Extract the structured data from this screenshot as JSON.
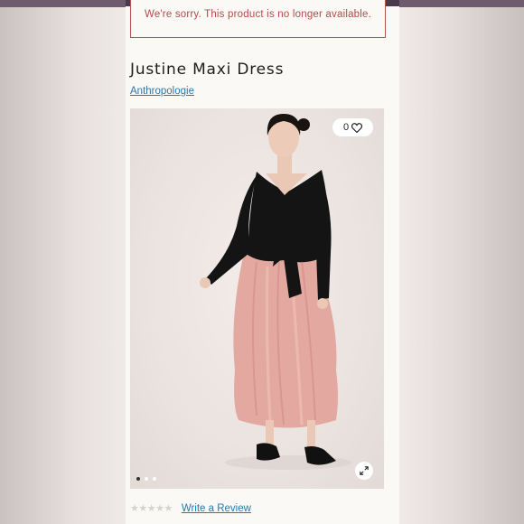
{
  "alert": {
    "message": "We're sorry. This product is no longer available."
  },
  "product": {
    "title": "Justine Maxi Dress",
    "brand": "Anthropologie",
    "image_alt": "Model wearing black wrap top and pink satin maxi skirt"
  },
  "wishlist": {
    "count": "0",
    "icon": "heart-icon"
  },
  "gallery": {
    "total_images": 3,
    "active_index": 0,
    "zoom_icon": "expand-icon"
  },
  "reviews": {
    "stars": "★★★★★",
    "rating": 0,
    "write_review_label": "Write a Review"
  },
  "colors": {
    "alert": "#b54a48",
    "link": "#2b78a8",
    "background": "#fbf9f6"
  }
}
